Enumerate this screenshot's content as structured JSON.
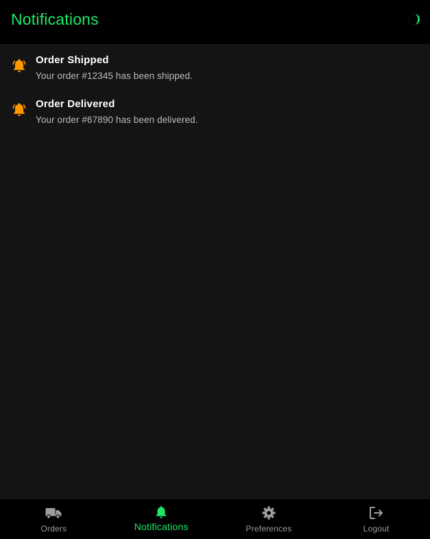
{
  "header": {
    "title": "Notifications",
    "theme_toggle_icon": "half-moon-icon"
  },
  "notifications": [
    {
      "icon": "bell-ringing-icon",
      "title": "Order Shipped",
      "body": "Your order #12345 has been shipped."
    },
    {
      "icon": "bell-ringing-icon",
      "title": "Order Delivered",
      "body": "Your order #67890 has been delivered."
    }
  ],
  "bottom_nav": {
    "items": [
      {
        "icon": "truck-icon",
        "label": "Orders",
        "active": false
      },
      {
        "icon": "bell-icon",
        "label": "Notifications",
        "active": true
      },
      {
        "icon": "gear-icon",
        "label": "Preferences",
        "active": false
      },
      {
        "icon": "logout-icon",
        "label": "Logout",
        "active": false
      }
    ]
  },
  "colors": {
    "accent": "#1ee86a",
    "bell": "#ff9800",
    "background": "#141414",
    "bar": "#000000",
    "muted": "#9e9e9e"
  }
}
